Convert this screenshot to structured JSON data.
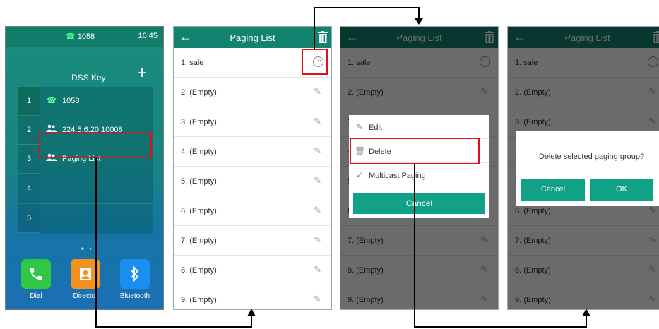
{
  "screen1": {
    "status_number": "1058",
    "status_time": "16:45",
    "title": "DSS Key",
    "add_symbol": "+",
    "key_numbers": [
      "1",
      "2",
      "3",
      "4",
      "5"
    ],
    "keys": [
      {
        "label": "1058",
        "icon": "phone-icon"
      },
      {
        "label": "224.5.6.20:10008",
        "icon": "group-icon"
      },
      {
        "label": "Paging List",
        "icon": "group-icon"
      },
      {
        "label": "",
        "icon": ""
      },
      {
        "label": "",
        "icon": ""
      }
    ],
    "apps": [
      {
        "label": "Dial",
        "icon": "phone-icon",
        "color": "#2ec846"
      },
      {
        "label": "Director",
        "icon": "contact-icon",
        "color": "#f39220"
      },
      {
        "label": "Bluetooth",
        "icon": "bluetooth-icon",
        "color": "#1b8ff0"
      }
    ]
  },
  "paging_list": {
    "title": "Paging List",
    "items": [
      "1. sale",
      "2. (Empty)",
      "3. (Empty)",
      "4. (Empty)",
      "5. (Empty)",
      "6. (Empty)",
      "7. (Empty)",
      "8. (Empty)",
      "9. (Empty)"
    ]
  },
  "option_menu": {
    "edit": "Edit",
    "delete": "Delete",
    "multicast": "Multicast Paging",
    "cancel": "Cancel"
  },
  "confirm_dialog": {
    "message": "Delete selected paging group?",
    "cancel": "Cancel",
    "ok": "OK"
  },
  "colors": {
    "titlebar": "#11836f",
    "button": "#11a187",
    "highlight": "#e0101d"
  }
}
